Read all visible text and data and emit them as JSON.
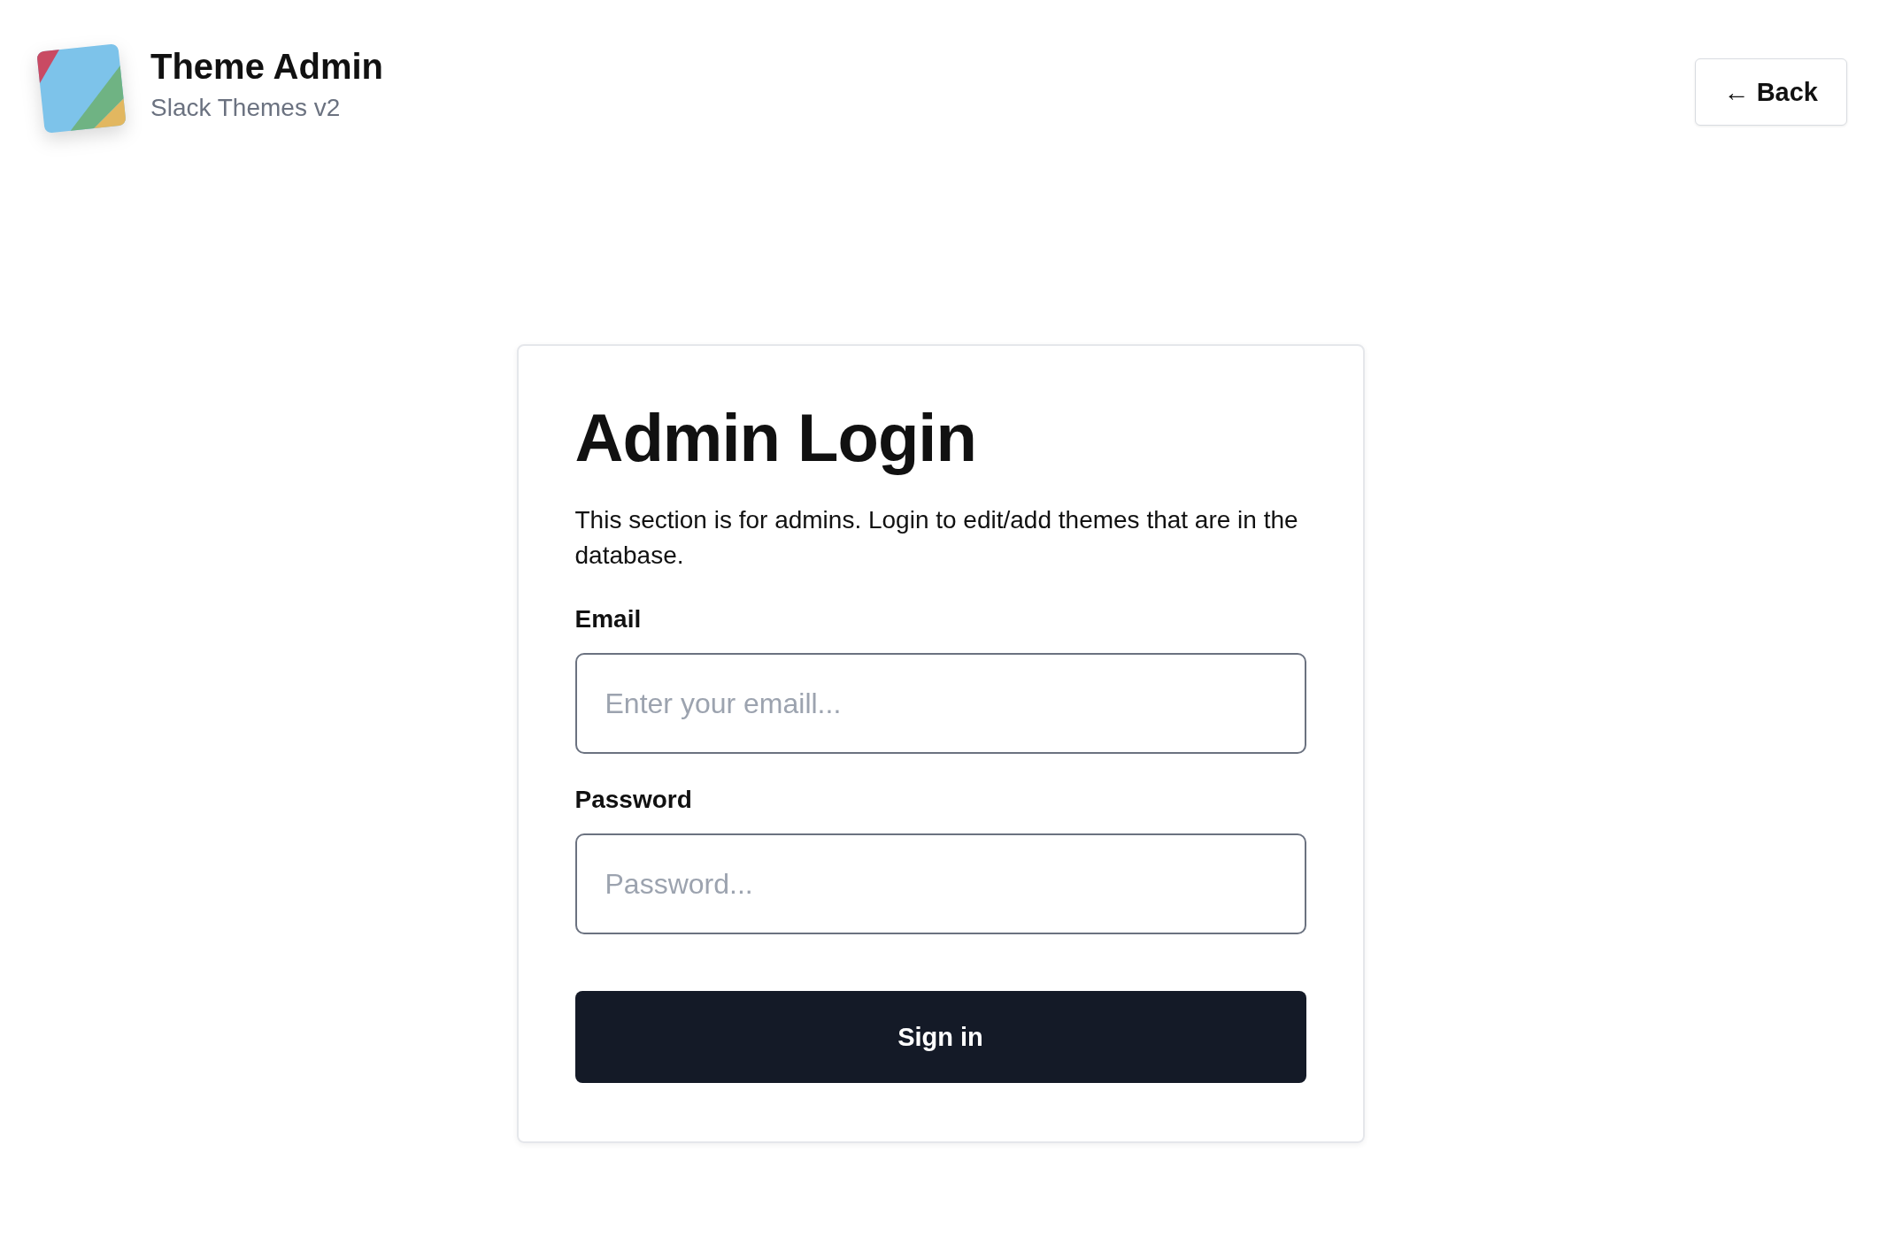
{
  "header": {
    "title": "Theme Admin",
    "subtitle": "Slack Themes v2",
    "back_button": {
      "icon": "←",
      "label": "Back"
    }
  },
  "login": {
    "title": "Admin Login",
    "description": "This section is for admins. Login to edit/add themes that are in the database.",
    "fields": [
      {
        "label": "Email",
        "placeholder": "Enter your emaill..."
      },
      {
        "label": "Password",
        "placeholder": "Password..."
      }
    ],
    "submit": "Sign in"
  }
}
